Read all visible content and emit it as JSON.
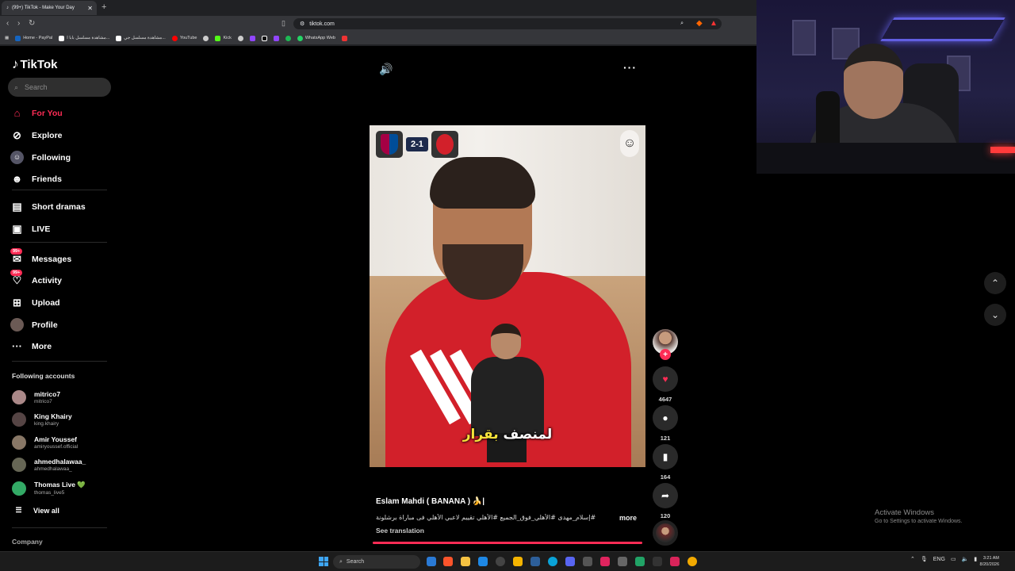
{
  "browser": {
    "tab_title": "(99+) TikTok - Make Your Day",
    "url": "tiktok.com",
    "bookmarks": [
      "Home - PayPal",
      "مشاهدة مسلسل بابا ا...",
      "مشاهدة مسلسل جي...",
      "YouTube",
      "Kick",
      "WhatsApp Web"
    ]
  },
  "sidebar": {
    "logo": "TikTok",
    "search_placeholder": "Search",
    "nav": [
      {
        "label": "For You",
        "icon": "home-icon"
      },
      {
        "label": "Explore",
        "icon": "compass-icon"
      },
      {
        "label": "Following",
        "icon": "following-icon"
      },
      {
        "label": "Friends",
        "icon": "friends-icon"
      },
      {
        "label": "Short dramas",
        "icon": "film-icon"
      },
      {
        "label": "LIVE",
        "icon": "live-icon"
      },
      {
        "label": "Messages",
        "icon": "messages-icon",
        "badge": "99+"
      },
      {
        "label": "Activity",
        "icon": "activity-icon",
        "badge": "99+"
      },
      {
        "label": "Upload",
        "icon": "upload-icon"
      },
      {
        "label": "Profile",
        "icon": "profile-icon"
      },
      {
        "label": "More",
        "icon": "more-icon"
      }
    ],
    "following_title": "Following accounts",
    "accounts": [
      {
        "name": "mitrico7",
        "handle": "mitrico7"
      },
      {
        "name": "King Khairy",
        "handle": "king.khairy"
      },
      {
        "name": "Amir Youssef",
        "handle": "amiryoussef.official"
      },
      {
        "name": "ahmedhalawaa_",
        "handle": "ahmedhalawaa_"
      },
      {
        "name": "Thomas Live 💚",
        "handle": "thomas_live5"
      }
    ],
    "view_all": "View all",
    "company": "Company"
  },
  "video": {
    "score": "2-1",
    "caption_white": "لمنصف",
    "caption_yellow": "بقرار",
    "author": "Eslam Mahdi ( BANANA ) 🍌|",
    "description": "#إسلام_مهدى #الأهلي_فوق_الجميع #الأهلي تقييم لاعبي الأهلي فى مباراة برشلونة",
    "more": "more",
    "see_translation": "See translation",
    "progress": 1.0,
    "likes": "4647",
    "comments": "121",
    "saves": "164",
    "shares": "120"
  },
  "windows": {
    "activate_title": "Activate Windows",
    "activate_sub": "Go to Settings to activate Windows.",
    "search": "Search",
    "lang": "ENG",
    "time": "3:21 AM",
    "date": "8/20/2026"
  },
  "colors": {
    "accent": "#fe2c55",
    "bg": "#000000"
  }
}
